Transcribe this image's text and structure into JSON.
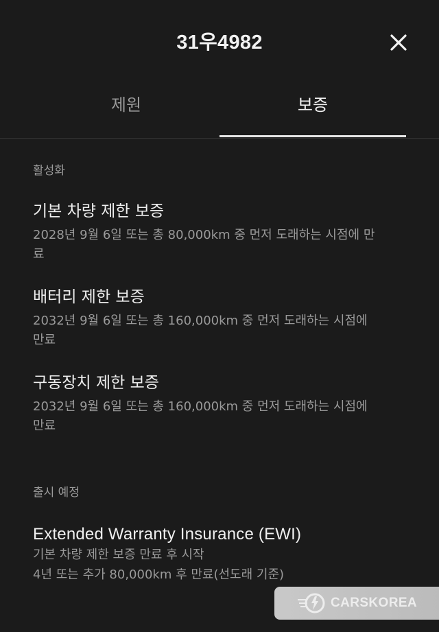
{
  "header": {
    "title": "31우4982",
    "close_icon": "close-icon"
  },
  "tabs": [
    {
      "label": "제원",
      "selected": false
    },
    {
      "label": "보증",
      "selected": true
    }
  ],
  "active_section": {
    "label": "활성화",
    "items": [
      {
        "title": "기본 차량 제한 보증",
        "desc_line1": "2028년 9월 6일 또는 총 80,000km 중 먼저 도래하는 시점에 만",
        "desc_line2": "료"
      },
      {
        "title": "배터리 제한 보증",
        "desc_line1": "2032년 9월 6일 또는 총 160,000km 중 먼저 도래하는 시점에",
        "desc_line2": "만료"
      },
      {
        "title": "구동장치 제한 보증",
        "desc_line1": "2032년 9월 6일 또는 총 160,000km 중 먼저 도래하는 시점에",
        "desc_line2": "만료"
      }
    ]
  },
  "upcoming_section": {
    "label": "출시 예정",
    "item": {
      "title": "Extended Warranty Insurance (EWI)",
      "line1": "기본 차량 제한 보증 만료 후 시작",
      "line2": "4년 또는 추가 80,000km 후 만료(선도래 기준)"
    }
  },
  "watermark": {
    "text": "CARSKOREA",
    "logo_icon": "carskorea-logo-icon"
  },
  "colors": {
    "background": "#1b1b1b",
    "primary_text": "#ededed",
    "secondary_text": "#9a9a9a",
    "tab_underline": "#e6e6e6"
  }
}
